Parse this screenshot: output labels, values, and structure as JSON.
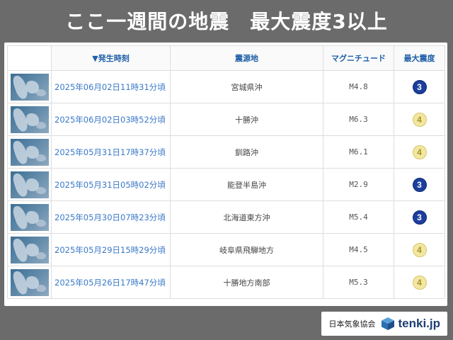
{
  "banner": {
    "title": "ここ一週間の地震　最大震度3以上"
  },
  "table": {
    "headers": {
      "time": "▼発生時刻",
      "place": "震源地",
      "magnitude": "マグニチュード",
      "intensity": "最大震度"
    },
    "rows": [
      {
        "time": "2025年06月02日11時31分頃",
        "place": "宮城県沖",
        "magnitude": "M4.8",
        "intensity": "3"
      },
      {
        "time": "2025年06月02日03時52分頃",
        "place": "十勝沖",
        "magnitude": "M6.3",
        "intensity": "4"
      },
      {
        "time": "2025年05月31日17時37分頃",
        "place": "釧路沖",
        "magnitude": "M6.1",
        "intensity": "4"
      },
      {
        "time": "2025年05月31日05時02分頃",
        "place": "能登半島沖",
        "magnitude": "M2.9",
        "intensity": "3"
      },
      {
        "time": "2025年05月30日07時23分頃",
        "place": "北海道東方沖",
        "magnitude": "M5.4",
        "intensity": "3"
      },
      {
        "time": "2025年05月29日15時29分頃",
        "place": "岐阜県飛騨地方",
        "magnitude": "M4.5",
        "intensity": "4"
      },
      {
        "time": "2025年05月26日17時47分頃",
        "place": "十勝地方南部",
        "magnitude": "M5.3",
        "intensity": "4"
      }
    ]
  },
  "footer": {
    "association": "日本気象協会",
    "logo_text": "tenki.jp"
  },
  "colors": {
    "intensity_3": "#1c3f9e",
    "intensity_4": "#f3e7a0",
    "link": "#3a78c8"
  }
}
